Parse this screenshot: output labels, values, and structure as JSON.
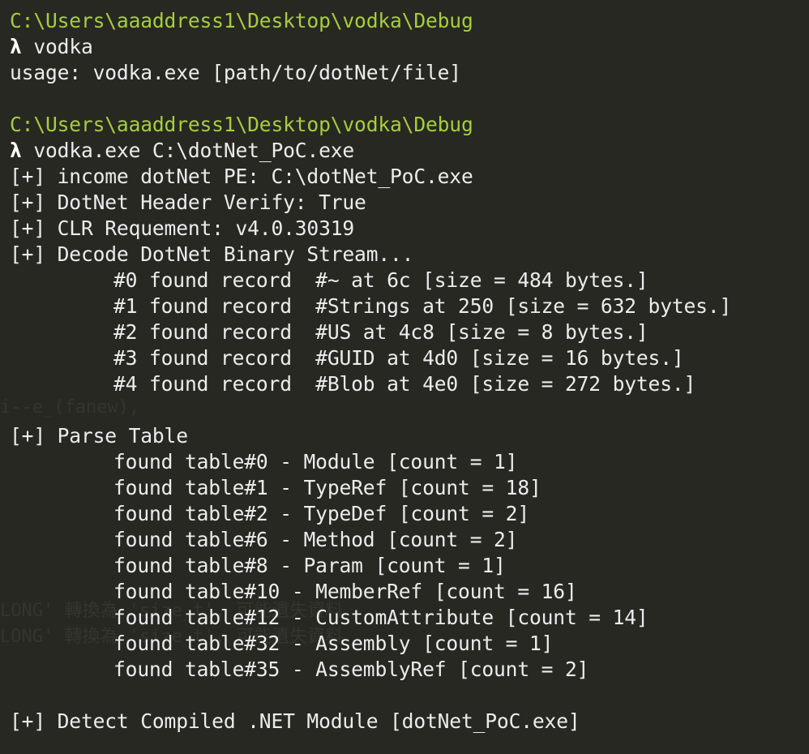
{
  "colors": {
    "background": "#272822",
    "text": "#ececec",
    "path": "#a7cd3e"
  },
  "ghost": {
    "line1": "i--e_(fanew),",
    "line2": "LONG' 轉換為 'size_t', 可能遺失資料",
    "line3": "LONG' 轉換為 'size_t', 可能遺失資料"
  },
  "session1": {
    "path": "C:\\Users\\aaaddress1\\Desktop\\vodka\\Debug",
    "prompt": "λ",
    "command": "vodka",
    "output": "usage: vodka.exe [path/to/dotNet/file]"
  },
  "session2": {
    "path": "C:\\Users\\aaaddress1\\Desktop\\vodka\\Debug",
    "prompt": "λ",
    "command": "vodka.exe C:\\dotNet_PoC.exe",
    "info": [
      "[+] income dotNet PE: C:\\dotNet_PoC.exe",
      "[+] DotNet Header Verify: True",
      "[+] CLR Requement: v4.0.30319",
      "[+] Decode DotNet Binary Stream..."
    ],
    "records": [
      "#0 found record  #~ at 6c [size = 484 bytes.]",
      "#1 found record  #Strings at 250 [size = 632 bytes.]",
      "#2 found record  #US at 4c8 [size = 8 bytes.]",
      "#3 found record  #GUID at 4d0 [size = 16 bytes.]",
      "#4 found record  #Blob at 4e0 [size = 272 bytes.]"
    ],
    "parse_header": "[+] Parse Table",
    "tables": [
      "found table#0 - Module [count = 1]",
      "found table#1 - TypeRef [count = 18]",
      "found table#2 - TypeDef [count = 2]",
      "found table#6 - Method [count = 2]",
      "found table#8 - Param [count = 1]",
      "found table#10 - MemberRef [count = 16]",
      "found table#12 - CustomAttribute [count = 14]",
      "found table#32 - Assembly [count = 1]",
      "found table#35 - AssemblyRef [count = 2]"
    ],
    "detect": "[+] Detect Compiled .NET Module [dotNet_PoC.exe]"
  }
}
